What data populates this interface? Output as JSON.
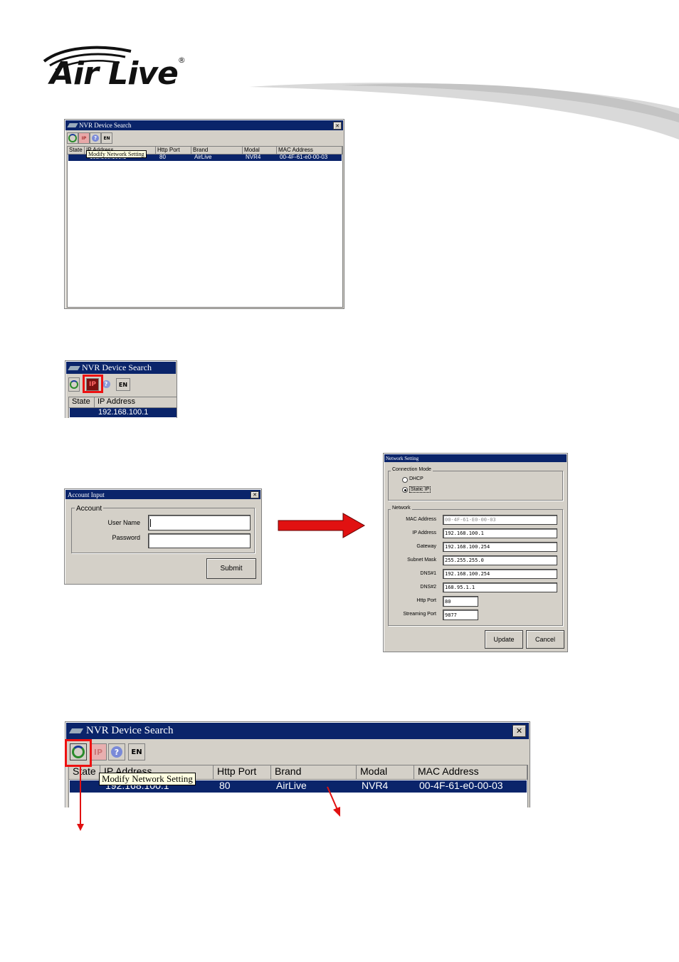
{
  "brand": {
    "logo": "Air Live",
    "reg": "®"
  },
  "win1": {
    "title": "NVR Device Search",
    "toolbar": [
      "search",
      "IP",
      "?",
      "EN"
    ],
    "columns": [
      "State",
      "IP Address",
      "Http Port",
      "Brand",
      "Modal",
      "MAC Address"
    ],
    "row": {
      "ip": "192.168.100.1",
      "port": "80",
      "brand": "AirLive",
      "model": "NVR4",
      "mac": "00-4F-61-e0-00-03"
    },
    "tooltip": "Modify Network Setting"
  },
  "win2": {
    "title": "NVR Device Search",
    "ip_button": "IP",
    "help_button": "?",
    "lang_button": "EN",
    "col_state": "State",
    "col_ip": "IP Address",
    "row_ip": "192.168.100.1"
  },
  "account": {
    "title": "Account Input",
    "group": "Account",
    "user_label": "User Name",
    "pass_label": "Password",
    "submit": "Submit"
  },
  "network": {
    "title": "Network Setting",
    "mode_group": "Connection Mode",
    "dhcp": "DHCP",
    "static": "Static IP",
    "net_group": "Network",
    "fields": [
      {
        "label": "MAC Address",
        "value": "00-4F-61-E0-00-03"
      },
      {
        "label": "IP Address",
        "value": "192.168.100.1"
      },
      {
        "label": "Gateway",
        "value": "192.168.100.254"
      },
      {
        "label": "Subnet Mask",
        "value": "255.255.255.0"
      },
      {
        "label": "DNS#1",
        "value": "192.168.100.254"
      },
      {
        "label": "DNS#2",
        "value": "168.95.1.1"
      },
      {
        "label": "Http Port",
        "value": "80"
      },
      {
        "label": "Streaming Port",
        "value": "9877"
      }
    ],
    "update": "Update",
    "cancel": "Cancel"
  },
  "win3": {
    "title": "NVR Device Search",
    "ip_button": "IP",
    "help_button": "?",
    "lang_button": "EN",
    "columns": [
      "State",
      "IP Address",
      "Http Port",
      "Brand",
      "Modal",
      "MAC Address"
    ],
    "row": {
      "ip": "192.168.100.1",
      "port": "80",
      "brand": "AirLive",
      "model": "NVR4",
      "mac": "00-4F-61-e0-00-03"
    },
    "tooltip": "Modify Network Setting"
  },
  "colors": {
    "titlebar": "#0a246a",
    "accent_red": "#e11111",
    "face": "#d4d0c8"
  }
}
